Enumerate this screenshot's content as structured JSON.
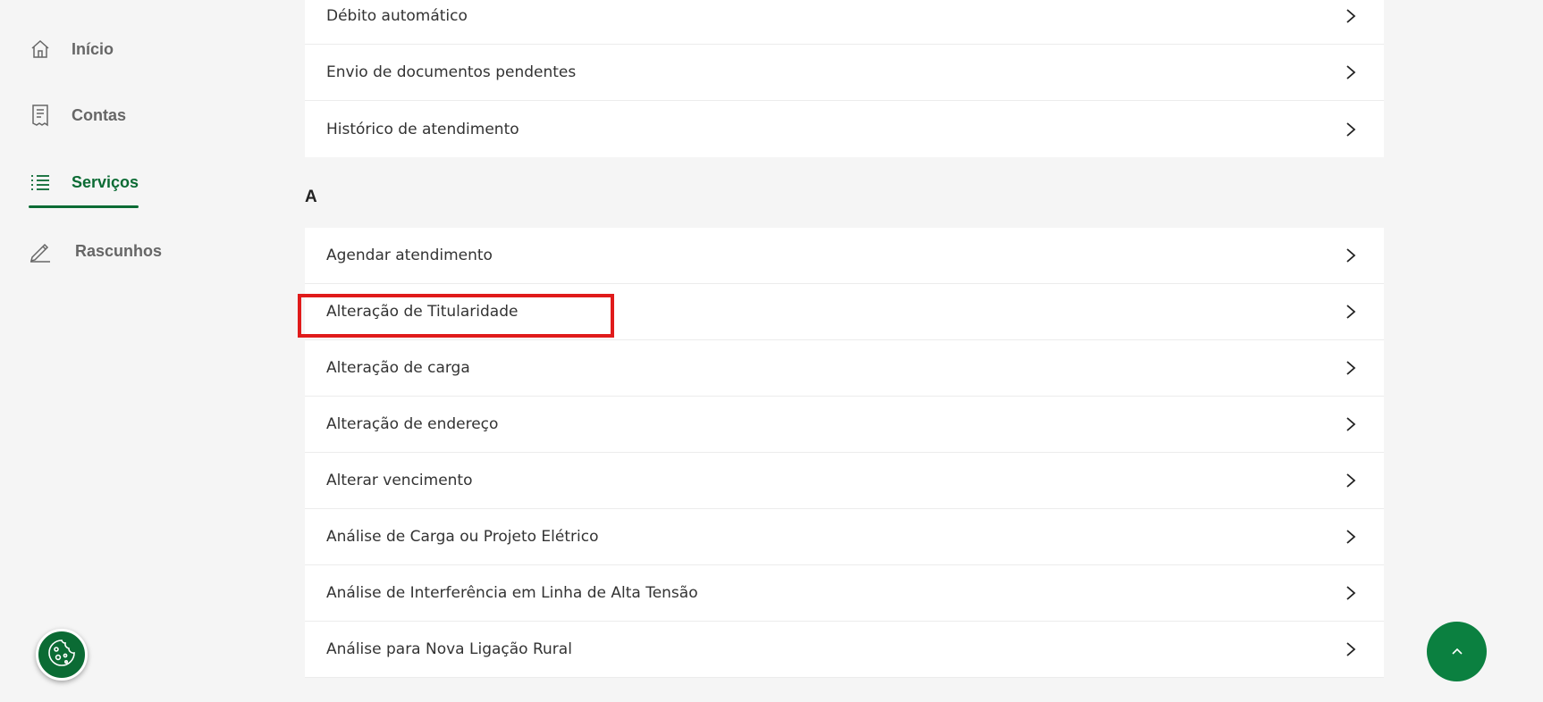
{
  "sidebar": {
    "items": [
      {
        "label": "Início",
        "icon": "home-icon"
      },
      {
        "label": "Contas",
        "icon": "receipt-icon"
      },
      {
        "label": "Serviços",
        "icon": "list-icon",
        "active": true
      },
      {
        "label": "Rascunhos",
        "icon": "pencil-icon"
      }
    ]
  },
  "main": {
    "top_list": [
      {
        "label": "Débito automático"
      },
      {
        "label": "Envio de documentos pendentes"
      },
      {
        "label": "Histórico de atendimento"
      }
    ],
    "section_letter": "A",
    "a_list": [
      {
        "label": "Agendar atendimento"
      },
      {
        "label": "Alteração de Titularidade"
      },
      {
        "label": "Alteração de carga"
      },
      {
        "label": "Alteração de endereço"
      },
      {
        "label": "Alterar vencimento"
      },
      {
        "label": "Análise de Carga ou Projeto Elétrico"
      },
      {
        "label": "Análise de Interferência em Linha de Alta Tensão"
      },
      {
        "label": "Análise para Nova Ligação Rural"
      }
    ]
  },
  "buttons": {
    "cookie": "cookie-icon",
    "scroll_top": "chevron-up-icon"
  },
  "colors": {
    "accent": "#0b6b34",
    "highlight": "#e01b1b",
    "background": "#f5f5f5"
  }
}
